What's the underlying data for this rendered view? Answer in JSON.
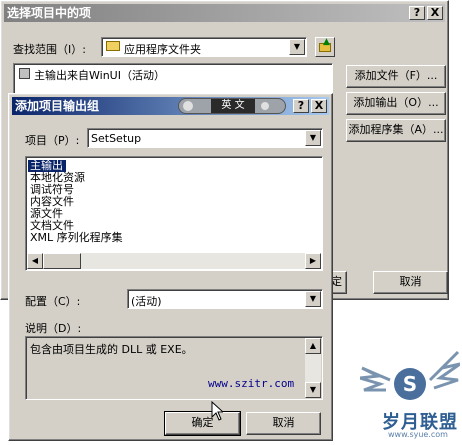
{
  "bg_dialog": {
    "title": "选择项目中的项",
    "title_buttons": [
      "?",
      "X"
    ],
    "lookin_label": "查找范围（I）:",
    "lookin_value": "应用程序文件夹",
    "list_item": "主输出来自WinUI（活动）",
    "buttons": [
      "添加文件（F）...",
      "添加输出（O）...",
      "添加程序集（A）..."
    ],
    "ok_partial": "定",
    "cancel_label": "取消"
  },
  "fg_dialog": {
    "title": "添加项目输出组",
    "title_buttons": [
      "?",
      "X"
    ],
    "ime_label": "英 文",
    "project_label": "项目（P）:",
    "project_value": "SetSetup",
    "outputs": [
      "主输出",
      "本地化资源",
      "调试符号",
      "内容文件",
      "源文件",
      "文档文件",
      "XML 序列化程序集"
    ],
    "config_label": "配置（C）:",
    "config_value": "(活动)",
    "description_label": "说明（D）:",
    "description_text": "包含由项目生成的 DLL 或 EXE。",
    "watermark_url": "www.szitr.com",
    "ok_label": "确定",
    "cancel_label": "取消"
  },
  "logo": {
    "text": "岁月联盟",
    "url": "www.syue.com"
  },
  "colors": {
    "face": "#d4d0c8",
    "active_title": "#0a246a",
    "inactive_title": "#808080",
    "selection": "#0a246a",
    "watermark": "#00008b"
  }
}
